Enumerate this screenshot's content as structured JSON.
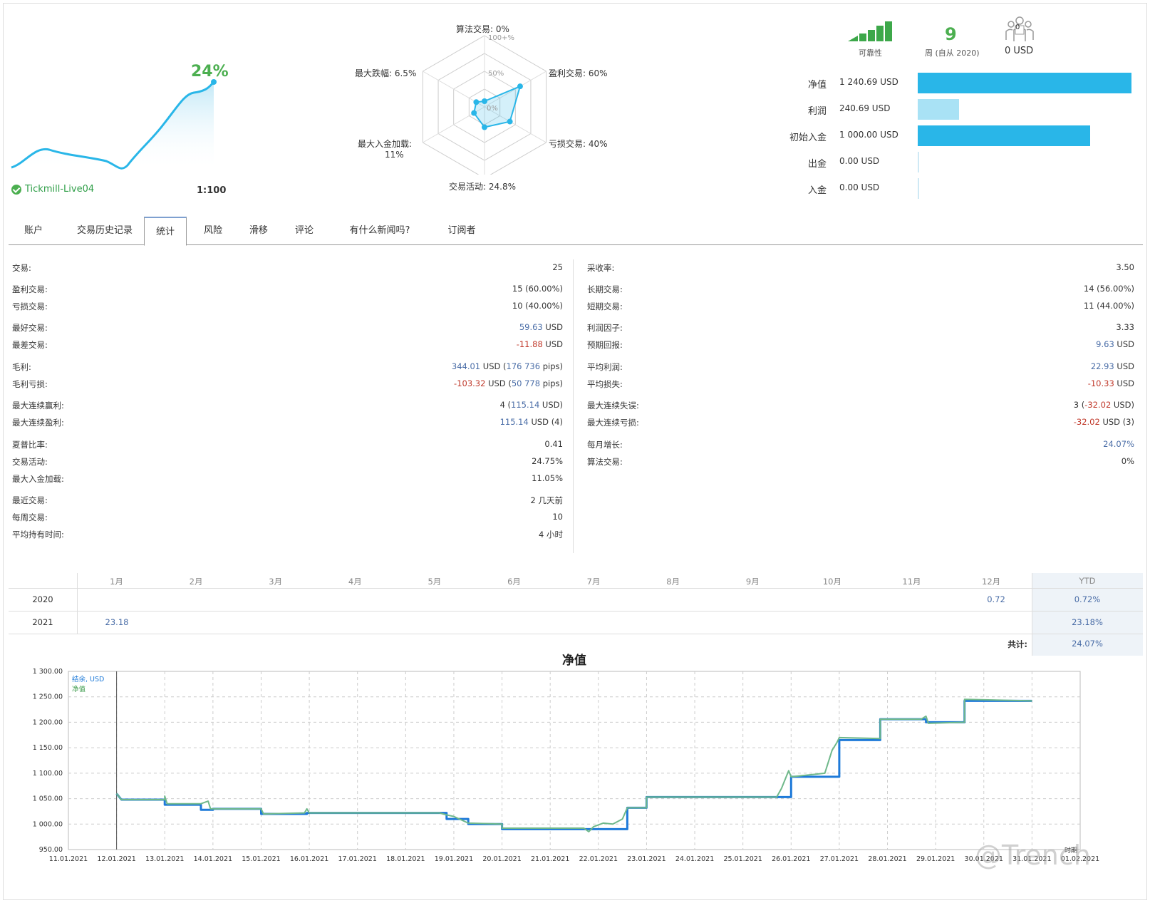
{
  "summary": {
    "growth": "24%",
    "broker": "Tickmill-Live04",
    "leverage": "1:100"
  },
  "radar": {
    "axes": [
      {
        "label": "算法交易: 0%",
        "value": 0
      },
      {
        "label": "盈利交易: 60%",
        "value": 60
      },
      {
        "label": "亏损交易: 40%",
        "value": 40
      },
      {
        "label": "交易活动: 24.8%",
        "value": 24.8
      },
      {
        "label": "最大入金加载:",
        "label2": "11%",
        "value": 11
      },
      {
        "label": "最大跌幅: 6.5%",
        "value": 6.5
      }
    ],
    "ring_labels": [
      "100+%",
      "50%",
      "0%"
    ]
  },
  "reliability": {
    "label": "可靠性"
  },
  "weeks": {
    "value": "9",
    "label": "周 (自从 2020)"
  },
  "subscribers": {
    "count": "0",
    "label": "0 USD"
  },
  "balances": [
    {
      "label": "净值",
      "value": "1 240.69 USD",
      "fraction": 1.0,
      "color": "#29b6e8"
    },
    {
      "label": "利润",
      "value": "240.69 USD",
      "fraction": 0.194,
      "color": "#a9e2f5"
    },
    {
      "label": "初始入金",
      "value": "1 000.00 USD",
      "fraction": 0.806,
      "color": "#29b6e8"
    },
    {
      "label": "出金",
      "value": "0.00 USD",
      "fraction": 0,
      "color": "#29b6e8"
    },
    {
      "label": "入金",
      "value": "0.00 USD",
      "fraction": 0,
      "color": "#29b6e8"
    }
  ],
  "tabs": [
    "账户",
    "交易历史记录",
    "统计",
    "风险",
    "滑移",
    "评论",
    "有什么新闻吗?",
    "订阅者"
  ],
  "stats_left": [
    {
      "label": "交易:",
      "value": "25"
    },
    {
      "label": "盈利交易:",
      "value": "15 (60.00%)"
    },
    {
      "label": "亏损交易:",
      "value": "10 (40.00%)"
    },
    {
      "label": "最好交易:",
      "v1": "59.63",
      "v2": " USD"
    },
    {
      "label": "最差交易:",
      "v1": "-11.88",
      "v2": " USD"
    },
    {
      "label": "毛利:",
      "v1": "344.01",
      "v2": " USD (",
      "v3": "176 736",
      "v4": " pips)"
    },
    {
      "label": "毛利亏损:",
      "v1": "-103.32",
      "v2": " USD (",
      "v3": "50 778",
      "v4": " pips)"
    },
    {
      "label": "最大连续赢利:",
      "v1": "4 (",
      "v2": "115.14",
      "v3": " USD)"
    },
    {
      "label": "最大连续盈利:",
      "v1": "115.14",
      "v2": " USD (4)"
    },
    {
      "label": "夏普比率:",
      "value": "0.41"
    },
    {
      "label": "交易活动:",
      "value": "24.75%"
    },
    {
      "label": "最大入金加载:",
      "value": "11.05%"
    },
    {
      "label": "最近交易:",
      "value": "2 几天前"
    },
    {
      "label": "每周交易:",
      "value": "10"
    },
    {
      "label": "平均持有时间:",
      "value": "4 小时"
    }
  ],
  "stats_right": [
    {
      "label": "采收率:",
      "value": "3.50"
    },
    {
      "label": "长期交易:",
      "value": "14 (56.00%)"
    },
    {
      "label": "短期交易:",
      "value": "11 (44.00%)"
    },
    {
      "label": "利润因子:",
      "value": "3.33"
    },
    {
      "label": "预期回报:",
      "v1": "9.63",
      "v2": " USD"
    },
    {
      "label": "平均利润:",
      "v1": "22.93",
      "v2": " USD"
    },
    {
      "label": "平均损失:",
      "v1": "-10.33",
      "v2": " USD"
    },
    {
      "label": "最大连续失误:",
      "v1": "3 (",
      "v2": "-32.02",
      "v3": " USD)"
    },
    {
      "label": "最大连续亏损:",
      "v1": "-32.02",
      "v2": " USD (3)"
    },
    {
      "label": "每月增长:",
      "value": "24.07%"
    },
    {
      "label": "算法交易:",
      "value": "0%"
    }
  ],
  "monthly": {
    "months": [
      "1月",
      "2月",
      "3月",
      "4月",
      "5月",
      "6月",
      "7月",
      "8月",
      "9月",
      "10月",
      "11月",
      "12月"
    ],
    "ytd_header": "YTD",
    "rows": [
      {
        "year": "2020",
        "dec": "0.72",
        "ytd": "0.72%"
      },
      {
        "year": "2021",
        "jan": "23.18",
        "ytd": "23.18%"
      }
    ],
    "total_label": "共计:",
    "total": "24.07%"
  },
  "chart_data": {
    "type": "line",
    "title": "净值",
    "legend": [
      "结余, USD",
      "净值"
    ],
    "xlabel": "时期",
    "x_ticks": [
      "11.01.2021",
      "12.01.2021",
      "13.01.2021",
      "14.01.2021",
      "15.01.2021",
      "16.01.2021",
      "17.01.2021",
      "18.01.2021",
      "19.01.2021",
      "20.01.2021",
      "21.01.2021",
      "22.01.2021",
      "23.01.2021",
      "24.01.2021",
      "25.01.2021",
      "26.01.2021",
      "27.01.2021",
      "28.01.2021",
      "29.01.2021",
      "30.01.2021",
      "31.01.2021",
      "01.02.2021"
    ],
    "y_ticks": [
      "950.00",
      "1 000.00",
      "1 050.00",
      "1 100.00",
      "1 150.00",
      "1 200.00",
      "1 250.00",
      "1 300.00"
    ],
    "ylim": [
      950,
      1300
    ],
    "series": [
      {
        "name": "结余, USD",
        "color": "#1e7ad9",
        "points": [
          [
            12.0,
            1060
          ],
          [
            12.1,
            1048
          ],
          [
            13.0,
            1048
          ],
          [
            13.0,
            1038
          ],
          [
            13.75,
            1038
          ],
          [
            13.75,
            1028
          ],
          [
            14.0,
            1028
          ],
          [
            14.0,
            1030
          ],
          [
            15.0,
            1030
          ],
          [
            15.0,
            1020
          ],
          [
            15.95,
            1020
          ],
          [
            15.95,
            1022
          ],
          [
            18.85,
            1022
          ],
          [
            18.85,
            1010
          ],
          [
            19.3,
            1010
          ],
          [
            19.3,
            1000
          ],
          [
            20.0,
            1000
          ],
          [
            20.0,
            990
          ],
          [
            21.7,
            990
          ],
          [
            22.6,
            990
          ],
          [
            22.6,
            1032
          ],
          [
            23.0,
            1032
          ],
          [
            23.0,
            1053
          ],
          [
            26.0,
            1053
          ],
          [
            26.0,
            1093
          ],
          [
            27.0,
            1093
          ],
          [
            27.0,
            1165
          ],
          [
            27.85,
            1165
          ],
          [
            27.85,
            1206
          ],
          [
            28.8,
            1206
          ],
          [
            28.8,
            1200
          ],
          [
            29.6,
            1200
          ],
          [
            29.6,
            1242
          ],
          [
            31.0,
            1242
          ]
        ]
      },
      {
        "name": "净值",
        "color": "#6fb88a",
        "points": [
          [
            12.0,
            1060
          ],
          [
            12.1,
            1048
          ],
          [
            13.0,
            1048
          ],
          [
            13.0,
            1055
          ],
          [
            13.05,
            1040
          ],
          [
            13.75,
            1040
          ],
          [
            13.9,
            1045
          ],
          [
            13.95,
            1030
          ],
          [
            14.0,
            1030
          ],
          [
            15.0,
            1030
          ],
          [
            15.05,
            1020
          ],
          [
            15.9,
            1022
          ],
          [
            15.95,
            1030
          ],
          [
            16.0,
            1022
          ],
          [
            18.7,
            1022
          ],
          [
            18.85,
            1018
          ],
          [
            19.0,
            1015
          ],
          [
            19.3,
            1002
          ],
          [
            20.0,
            1000
          ],
          [
            20.0,
            992
          ],
          [
            21.7,
            992
          ],
          [
            21.8,
            985
          ],
          [
            21.9,
            995
          ],
          [
            22.1,
            1002
          ],
          [
            22.3,
            1000
          ],
          [
            22.5,
            1010
          ],
          [
            22.6,
            1032
          ],
          [
            23.0,
            1032
          ],
          [
            23.0,
            1053
          ],
          [
            25.7,
            1053
          ],
          [
            25.8,
            1070
          ],
          [
            25.95,
            1105
          ],
          [
            26.0,
            1093
          ],
          [
            26.7,
            1100
          ],
          [
            26.85,
            1145
          ],
          [
            26.95,
            1160
          ],
          [
            27.0,
            1170
          ],
          [
            27.85,
            1168
          ],
          [
            27.85,
            1206
          ],
          [
            28.7,
            1206
          ],
          [
            28.8,
            1212
          ],
          [
            28.85,
            1198
          ],
          [
            29.6,
            1200
          ],
          [
            29.6,
            1245
          ],
          [
            31.0,
            1242
          ]
        ]
      }
    ]
  }
}
